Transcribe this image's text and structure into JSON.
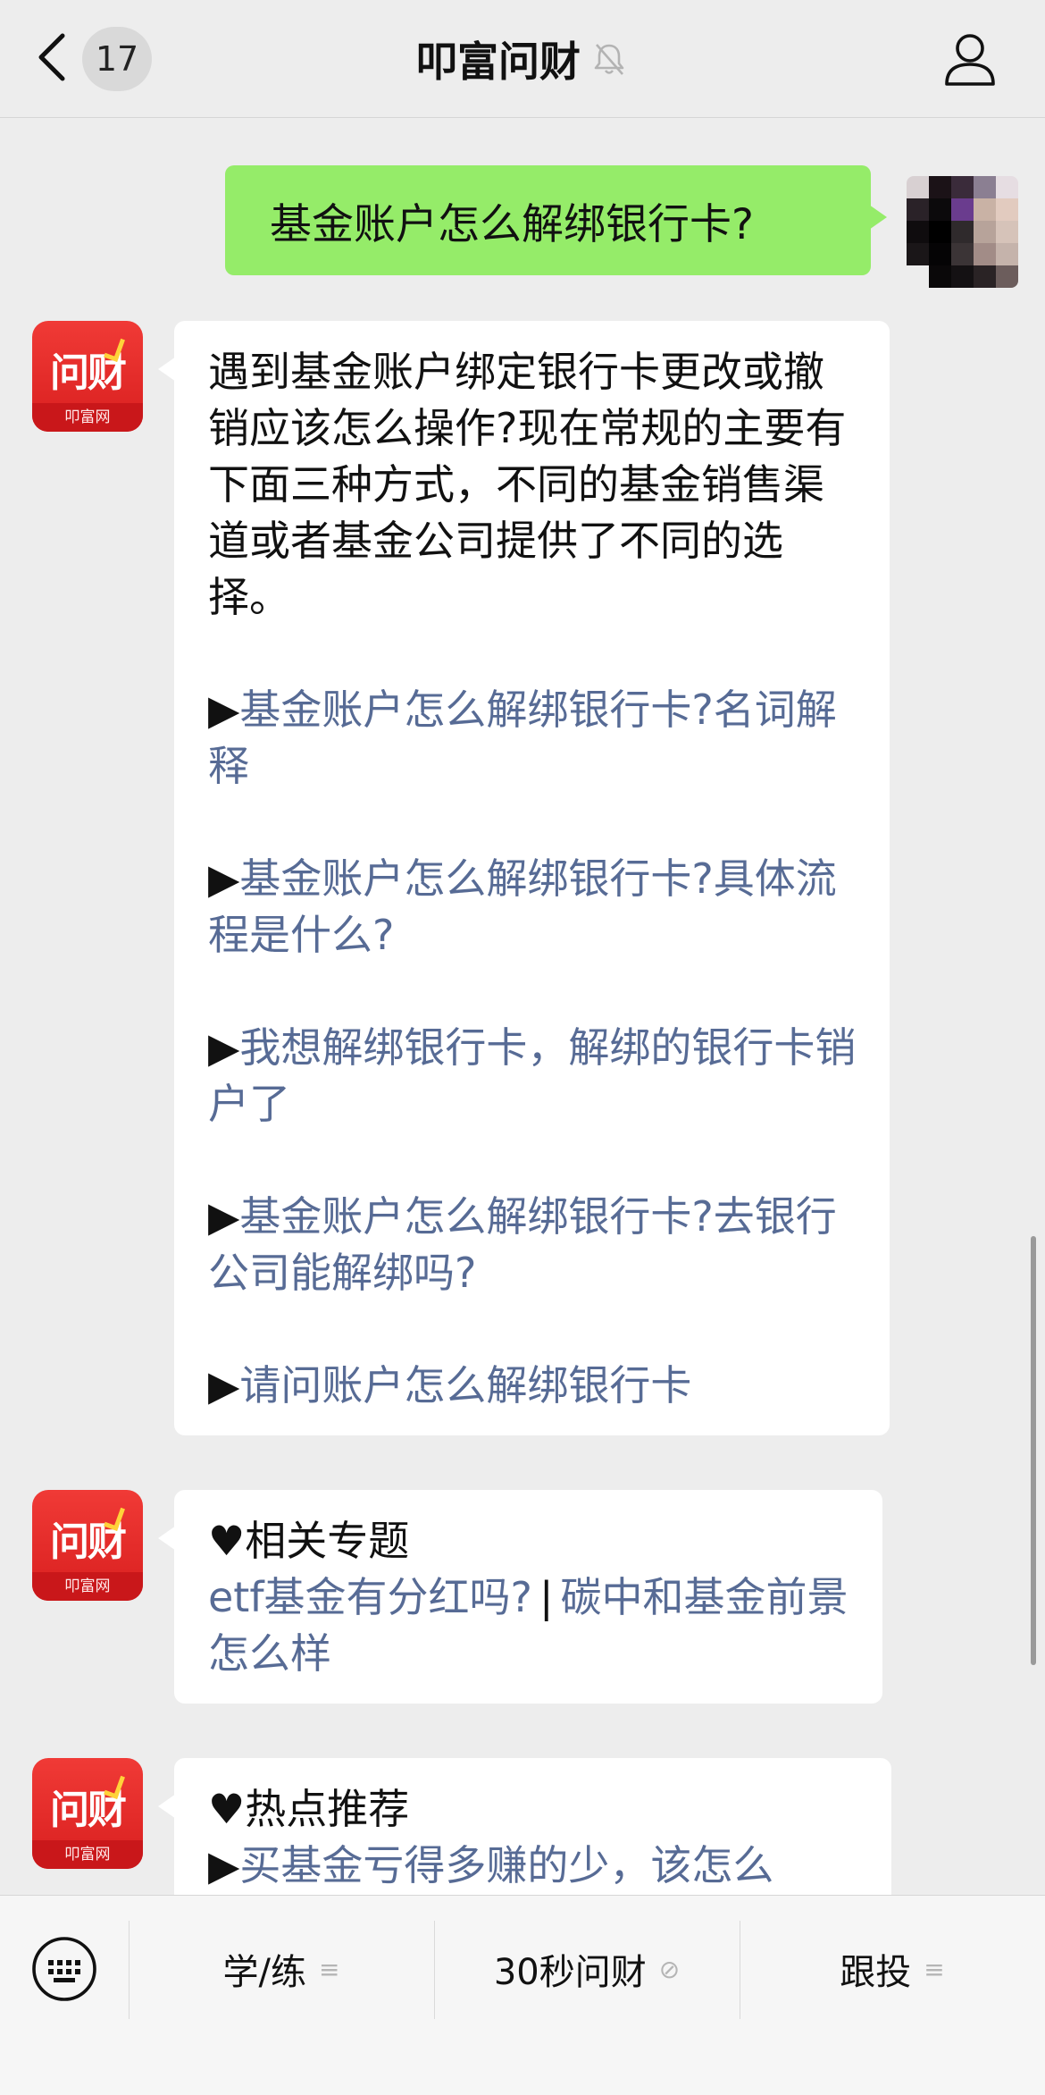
{
  "header": {
    "unread_count": "17",
    "title": "叩富问财"
  },
  "user_message": {
    "text": "基金账户怎么解绑银行卡?"
  },
  "bot_logo": {
    "text": "问财",
    "sub": "叩富网"
  },
  "messages": [
    {
      "intro": "遇到基金账户绑定银行卡更改或撤销应该怎么操作?现在常规的主要有下面三种方式，不同的基金销售渠道或者基金公司提供了不同的选择。",
      "links": [
        {
          "marker": "▶",
          "text": "基金账户怎么解绑银行卡?名词解释"
        },
        {
          "marker": "▶",
          "text": "基金账户怎么解绑银行卡?具体流程是什么?"
        },
        {
          "marker": "▶",
          "text": "我想解绑银行卡，解绑的银行卡销户了"
        },
        {
          "marker": "▶",
          "text": "基金账户怎么解绑银行卡?去银行公司能解绑吗?"
        },
        {
          "marker": "▶",
          "text": "请问账户怎么解绑银行卡"
        }
      ]
    },
    {
      "heading_marker": "♥",
      "heading": "相关专题",
      "links": [
        "etf基金有分红吗?",
        "碳中和基金前景怎么样"
      ],
      "separator": "|"
    },
    {
      "heading_marker": "♥",
      "heading": "热点推荐",
      "link_marker": "▶",
      "link": "买基金亏得多赚的少，该怎么"
    }
  ],
  "bottom_menu": {
    "items": [
      {
        "label": "学/练",
        "icon": "≡"
      },
      {
        "label": "30秒问财",
        "icon": "⊘"
      },
      {
        "label": "跟投",
        "icon": "≡"
      }
    ]
  },
  "colors": {
    "user_bubble": "#95ec69",
    "link": "#576b95",
    "brand_red": "#e52c2c",
    "background": "#ededed"
  }
}
